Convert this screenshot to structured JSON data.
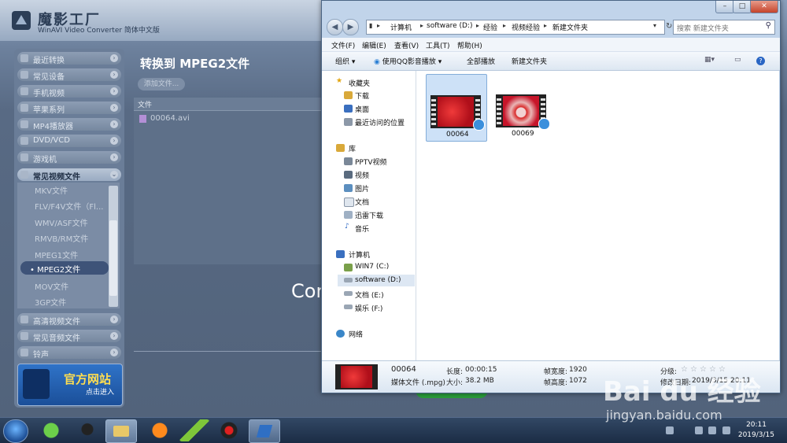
{
  "app": {
    "name": "魔影工厂",
    "subtitle": "WinAVI Video Converter 简体中文版",
    "main_title": "转换到 MPEG2文件",
    "add_file_label": "添加文件...",
    "file_column": "文件",
    "file_name": "00064.avi",
    "convert_partial_text": "Cor",
    "nav": [
      {
        "label": "最近转换"
      },
      {
        "label": "常见设备"
      },
      {
        "label": "手机视频"
      },
      {
        "label": "苹果系列"
      },
      {
        "label": "MP4播放器"
      },
      {
        "label": "DVD/VCD"
      },
      {
        "label": "游戏机"
      },
      {
        "label": "常见视频文件"
      }
    ],
    "video_formats": [
      "MKV文件",
      "FLV/F4V文件（Fl...",
      "WMV/ASF文件",
      "RMVB/RM文件",
      "MPEG1文件",
      "• MPEG2文件",
      "MOV文件",
      "3GP文件"
    ],
    "nav_bottom": [
      {
        "label": "高清视频文件"
      },
      {
        "label": "常见音频文件"
      },
      {
        "label": "铃声"
      }
    ],
    "banner": {
      "title": "官方网站",
      "sub": "点击进入"
    }
  },
  "explorer": {
    "breadcrumb": [
      "计算机",
      "software (D:)",
      "经验",
      "视频经验",
      "新建文件夹"
    ],
    "search_placeholder": "搜索 新建文件夹",
    "menus": [
      "文件(F)",
      "编辑(E)",
      "查看(V)",
      "工具(T)",
      "帮助(H)"
    ],
    "toolbar": {
      "organize": "组织",
      "qq": "使用QQ影音播放",
      "play_all": "全部播放",
      "new_folder": "新建文件夹"
    },
    "nav_pane": {
      "favorites": "收藏夹",
      "fav_items": [
        "下载",
        "桌面",
        "最近访问的位置"
      ],
      "libraries": "库",
      "lib_items": [
        "PPTV视频",
        "视频",
        "图片",
        "文档",
        "迅雷下载",
        "音乐"
      ],
      "computer": "计算机",
      "drives": [
        "WIN7 (C:)",
        "software (D:)",
        "文档 (E:)",
        "娱乐 (F:)"
      ],
      "network": "网络"
    },
    "items": [
      {
        "name": "00064"
      },
      {
        "name": "00069"
      }
    ],
    "details": {
      "name": "00064",
      "type": "媒体文件 (.mpg)",
      "length_label": "长度:",
      "length_value": "00:00:15",
      "size_label": "大小:",
      "size_value": "38.2 MB",
      "frame_width_label": "帧宽度:",
      "frame_width_value": "1920",
      "frame_height_label": "帧高度:",
      "frame_height_value": "1072",
      "rating_label": "分级:",
      "date_label": "修改日期:",
      "date_value": "2019/3/15 20:11"
    }
  },
  "taskbar": {
    "time": "20:11",
    "date": "2019/3/15"
  },
  "watermark": {
    "line1": "Bai du 经验",
    "line2": "jingyan.baidu.com"
  },
  "colors": {
    "accent": "#3e5378",
    "explorer_frame": "#c1d4ea",
    "selection": "#cde1f7"
  }
}
